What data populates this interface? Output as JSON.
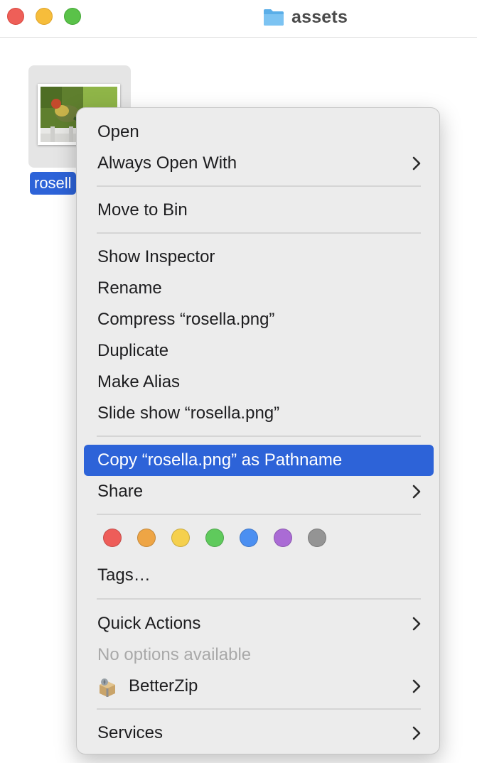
{
  "window": {
    "title": "assets"
  },
  "file": {
    "name": "rosella.png",
    "label_visible": "rosell"
  },
  "menu": {
    "open": "Open",
    "always_open_with": "Always Open With",
    "move_to_bin": "Move to Bin",
    "show_inspector": "Show Inspector",
    "rename": "Rename",
    "compress": "Compress “rosella.png”",
    "duplicate": "Duplicate",
    "make_alias": "Make Alias",
    "slide_show": "Slide show “rosella.png”",
    "copy_pathname": "Copy “rosella.png” as Pathname",
    "share": "Share",
    "tags": "Tags…",
    "quick_actions": "Quick Actions",
    "no_options": "No options available",
    "betterzip": "BetterZip",
    "services": "Services"
  },
  "tag_colors": [
    "#ee5d59",
    "#eea545",
    "#f5d04d",
    "#5fca5c",
    "#4b8ff1",
    "#aa6bd5",
    "#949494"
  ],
  "colors": {
    "highlight": "#2d63d8",
    "menu_bg": "#ececec"
  }
}
